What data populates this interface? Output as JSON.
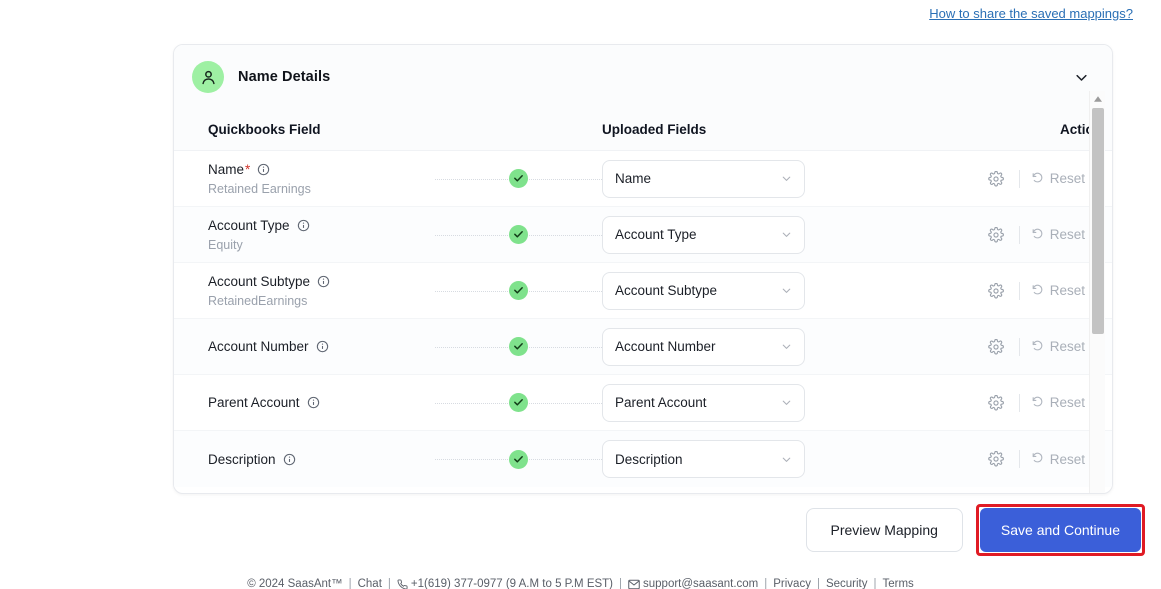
{
  "top": {
    "help_link": "How to share the saved mappings?"
  },
  "card": {
    "title": "Name Details",
    "avatar_icon": "person-icon",
    "avatar_bg": "#9ef0a3",
    "collapse_icon": "chevron-down-icon",
    "columns": {
      "field": "Quickbooks Field",
      "uploaded": "Uploaded Fields",
      "action": "Action"
    },
    "rows": [
      {
        "label": "Name",
        "required": true,
        "required_mark": "*",
        "sub": "Retained Earnings",
        "info_icon": "info-icon",
        "status_icon": "check-circle-icon",
        "mapped_value": "Name",
        "caret_icon": "chevron-down-icon",
        "gear_icon": "gear-icon",
        "reset_icon": "undo-arrow-icon",
        "reset_label": "Reset"
      },
      {
        "label": "Account Type",
        "required": false,
        "required_mark": "",
        "sub": "Equity",
        "info_icon": "info-icon",
        "status_icon": "check-circle-icon",
        "mapped_value": "Account Type",
        "caret_icon": "chevron-down-icon",
        "gear_icon": "gear-icon",
        "reset_icon": "undo-arrow-icon",
        "reset_label": "Reset"
      },
      {
        "label": "Account Subtype",
        "required": false,
        "required_mark": "",
        "sub": "RetainedEarnings",
        "info_icon": "info-icon",
        "status_icon": "check-circle-icon",
        "mapped_value": "Account Subtype",
        "caret_icon": "chevron-down-icon",
        "gear_icon": "gear-icon",
        "reset_icon": "undo-arrow-icon",
        "reset_label": "Reset"
      },
      {
        "label": "Account Number",
        "required": false,
        "required_mark": "",
        "sub": "",
        "info_icon": "info-icon",
        "status_icon": "check-circle-icon",
        "mapped_value": "Account Number",
        "caret_icon": "chevron-down-icon",
        "gear_icon": "gear-icon",
        "reset_icon": "undo-arrow-icon",
        "reset_label": "Reset"
      },
      {
        "label": "Parent Account",
        "required": false,
        "required_mark": "",
        "sub": "",
        "info_icon": "info-icon",
        "status_icon": "check-circle-icon",
        "mapped_value": "Parent Account",
        "caret_icon": "chevron-down-icon",
        "gear_icon": "gear-icon",
        "reset_icon": "undo-arrow-icon",
        "reset_label": "Reset"
      },
      {
        "label": "Description",
        "required": false,
        "required_mark": "",
        "sub": "",
        "info_icon": "info-icon",
        "status_icon": "check-circle-icon",
        "mapped_value": "Description",
        "caret_icon": "chevron-down-icon",
        "gear_icon": "gear-icon",
        "reset_icon": "undo-arrow-icon",
        "reset_label": "Reset"
      }
    ]
  },
  "scrollbar": {
    "up_icon": "triangle-up-icon",
    "down_icon": "triangle-down-icon"
  },
  "actions": {
    "preview_label": "Preview Mapping",
    "save_label": "Save and Continue",
    "save_bg": "#3b5fd9",
    "highlight_color": "#e01b24"
  },
  "footer": {
    "copyright": "© 2024 SaasAnt™",
    "chat": "Chat",
    "phone_icon": "phone-icon",
    "phone": "+1(619) 377-0977 (9 A.M to 5 P.M EST)",
    "mail_icon": "envelope-icon",
    "email": "support@saasant.com",
    "privacy": "Privacy",
    "security": "Security",
    "terms": "Terms",
    "separator": "|"
  }
}
